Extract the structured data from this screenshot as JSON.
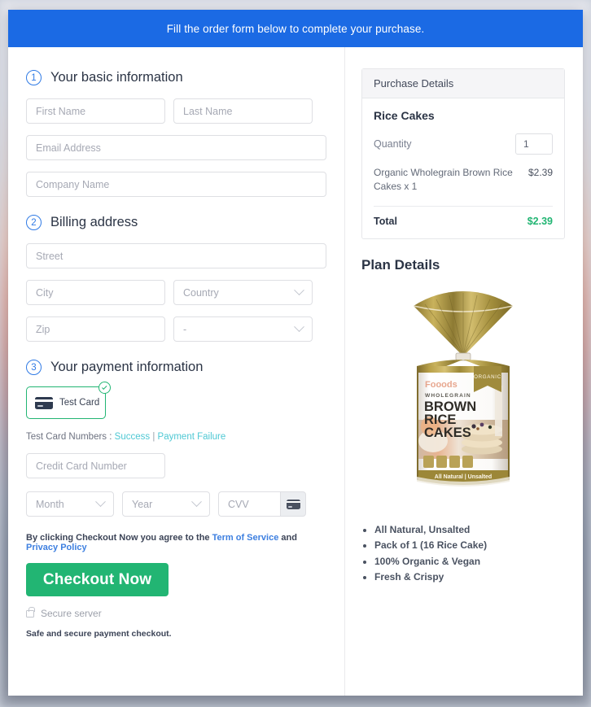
{
  "banner": {
    "text": "Fill the order form below to complete your purchase."
  },
  "steps": {
    "basic": {
      "num": "1",
      "title": "Your basic information"
    },
    "billing": {
      "num": "2",
      "title": "Billing address"
    },
    "payment": {
      "num": "3",
      "title": "Your payment information"
    }
  },
  "form": {
    "first_name_placeholder": "First Name",
    "last_name_placeholder": "Last Name",
    "email_placeholder": "Email Address",
    "company_placeholder": "Company Name",
    "street_placeholder": "Street",
    "city_placeholder": "City",
    "country_placeholder": "Country",
    "zip_placeholder": "Zip",
    "state_placeholder": "-",
    "credit_card_placeholder": "Credit Card Number",
    "month_placeholder": "Month",
    "year_placeholder": "Year",
    "cvv_placeholder": "CVV"
  },
  "payment": {
    "tile_label": "Test  Card",
    "test_cards_label": "Test Card Numbers :",
    "success_link": "Success",
    "separator": "|",
    "failure_link": "Payment Failure"
  },
  "terms": {
    "prefix": "By clicking Checkout Now you agree to the",
    "tos_link": "Term of Service",
    "and": "and",
    "privacy_link": "Privacy Policy"
  },
  "actions": {
    "checkout_label": "Checkout Now",
    "secure_server": "Secure server",
    "safe_note": "Safe and secure payment checkout."
  },
  "purchase": {
    "panel_title": "Purchase Details",
    "product_name": "Rice Cakes",
    "quantity_label": "Quantity",
    "quantity_value": "1",
    "line_item_desc": "Organic Wholegrain Brown Rice Cakes x 1",
    "line_item_amount": "$2.39",
    "total_label": "Total",
    "total_amount": "$2.39"
  },
  "plan": {
    "title": "Plan Details",
    "package": {
      "badge": "ORGANIC",
      "brand": "Fooods",
      "line1": "WHOLEGRAIN",
      "line2": "BROWN",
      "line3": "RICE",
      "line4": "CAKES",
      "footer": "All Natural | Unsalted"
    },
    "bullets": [
      "All Natural, Unsalted",
      "Pack of 1 (16 Rice Cake)",
      "100% Organic & Vegan",
      "Fresh & Crispy"
    ]
  },
  "colors": {
    "banner_blue": "#1b6ae4",
    "accent_green": "#22b573",
    "link_blue": "#3d7fe0",
    "link_teal": "#4ec8d4",
    "step_blue": "#2f7ae5"
  }
}
